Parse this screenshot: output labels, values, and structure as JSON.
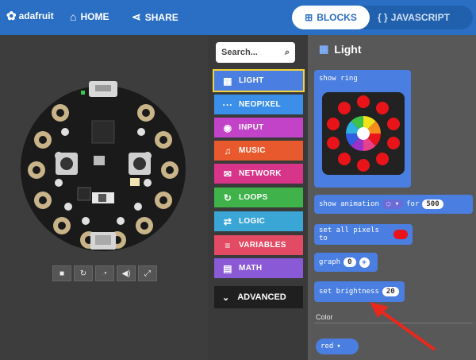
{
  "header": {
    "brand": "adafruit",
    "home_label": "HOME",
    "share_label": "SHARE",
    "blocks_label": "BLOCKS",
    "javascript_label": "JAVASCRIPT"
  },
  "toolbox": {
    "search_placeholder": "Search...",
    "categories": [
      {
        "label": "LIGHT",
        "color": "#4a7ee0",
        "icon": "grid-icon"
      },
      {
        "label": "NEOPIXEL",
        "color": "#3b8fe8",
        "icon": "dots-icon"
      },
      {
        "label": "INPUT",
        "color": "#c242c8",
        "icon": "target-icon"
      },
      {
        "label": "MUSIC",
        "color": "#e85a2e",
        "icon": "headphones-icon"
      },
      {
        "label": "NETWORK",
        "color": "#d8348a",
        "icon": "chat-icon"
      },
      {
        "label": "LOOPS",
        "color": "#3fb24a",
        "icon": "refresh-icon"
      },
      {
        "label": "LOGIC",
        "color": "#3aa6d6",
        "icon": "shuffle-icon"
      },
      {
        "label": "VARIABLES",
        "color": "#e24b63",
        "icon": "list-icon"
      },
      {
        "label": "MATH",
        "color": "#8a5ad6",
        "icon": "calculator-icon"
      }
    ],
    "advanced_label": "ADVANCED"
  },
  "flyout": {
    "title": "Light",
    "show_ring_label": "show ring",
    "show_animation_label": "show animation",
    "for_label": "for",
    "duration_value": "500",
    "set_all_pixels_label": "set all pixels to",
    "graph_label": "graph",
    "graph_value": "0",
    "set_brightness_label": "set brightness",
    "brightness_value": "20",
    "color_section_label": "Color",
    "color_dropdown_value": "red"
  },
  "colors": {
    "accent": "#2b6fc4",
    "block_blue": "#4a7ee0",
    "arrow_red": "#e8281c"
  }
}
